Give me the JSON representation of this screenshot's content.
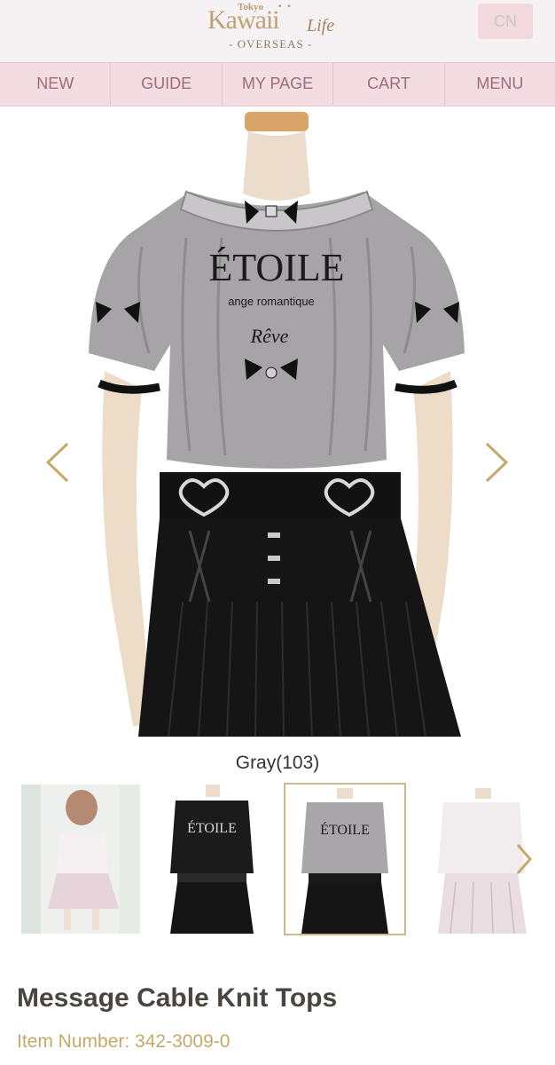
{
  "header": {
    "logo": {
      "tokyo": "Tokyo",
      "kawaii": "Kawaii",
      "life": "Life",
      "overseas": "- OVERSEAS -"
    },
    "lang_button": "CN"
  },
  "nav": {
    "items": [
      {
        "label": "NEW"
      },
      {
        "label": "GUIDE"
      },
      {
        "label": "MY PAGE"
      },
      {
        "label": "CART"
      },
      {
        "label": "MENU"
      }
    ]
  },
  "product_image": {
    "garment_text": {
      "brand": "ÉTOILE",
      "tagline": "ange romantique",
      "script": "Rêve"
    }
  },
  "selected_color": "Gray(103)",
  "thumbnails": [
    {
      "variant": "model-photo",
      "selected": false
    },
    {
      "variant": "black",
      "selected": false,
      "garment_text": "ÉTOILE"
    },
    {
      "variant": "gray",
      "selected": true,
      "garment_text": "ÉTOILE"
    },
    {
      "variant": "white",
      "selected": false
    }
  ],
  "product": {
    "title": "Message Cable Knit Tops",
    "item_number": "Item Number: 342-3009-0"
  },
  "colors": {
    "accent_gold": "#c4a96a",
    "nav_bg": "#f3dce2",
    "nav_text": "#9a6e78",
    "header_bg": "#f6f2f3"
  },
  "icons": {
    "prev": "chevron-left-icon",
    "next": "chevron-right-icon",
    "thumb_next": "chevron-right-icon"
  }
}
